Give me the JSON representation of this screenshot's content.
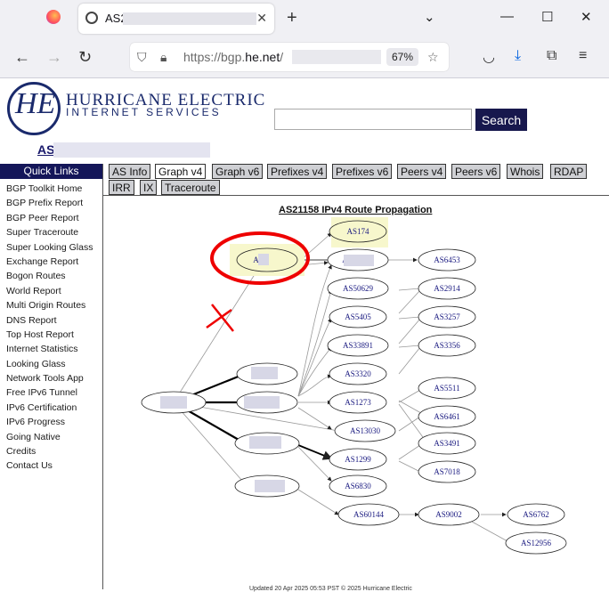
{
  "browser": {
    "tab_title": "AS2",
    "url_prefix": "https://bgp.",
    "url_host": "he.net",
    "url_suffix": "/",
    "zoom": "67%",
    "colors": {
      "chrome": "#f0f0f4",
      "accent": "#0060df"
    }
  },
  "header": {
    "logo_text": "HE",
    "company_line1": "HURRICANE ELECTRIC",
    "company_line2": "INTERNET SERVICES",
    "search_button": "Search",
    "as_title": "AS"
  },
  "quick_links": {
    "heading": "Quick Links",
    "items": [
      "BGP Toolkit Home",
      "BGP Prefix Report",
      "BGP Peer Report",
      "Super Traceroute",
      "Super Looking Glass",
      "Exchange Report",
      "Bogon Routes",
      "World Report",
      "Multi Origin Routes",
      "DNS Report",
      "Top Host Report",
      "Internet Statistics",
      "Looking Glass",
      "Network Tools App",
      "Free IPv6 Tunnel",
      "IPv6 Certification",
      "IPv6 Progress",
      "Going Native",
      "Credits",
      "Contact Us"
    ]
  },
  "tabs": [
    "AS Info",
    "Graph v4",
    "Graph v6",
    "Prefixes v4",
    "Prefixes v6",
    "Peers v4",
    "Peers v6",
    "Whois",
    "RDAP",
    "IRR",
    "IX",
    "Traceroute"
  ],
  "active_tab": "Graph v4",
  "graph": {
    "title": "AS21158 IPv4 Route Propagation",
    "nodes": [
      "AS174",
      "AS",
      "AS",
      "AS6453",
      "AS50629",
      "AS2914",
      "AS5405",
      "AS3257",
      "AS33891",
      "AS3356",
      "AS3320",
      "AS5511",
      "AS1273",
      "AS6461",
      "AS13030",
      "AS3491",
      "AS1299",
      "AS7018",
      "AS6830",
      "AS60144",
      "AS9002",
      "AS6762",
      "AS12956"
    ]
  },
  "footer": "Updated 20 Apr 2025 05:53 PST © 2025 Hurricane Electric"
}
